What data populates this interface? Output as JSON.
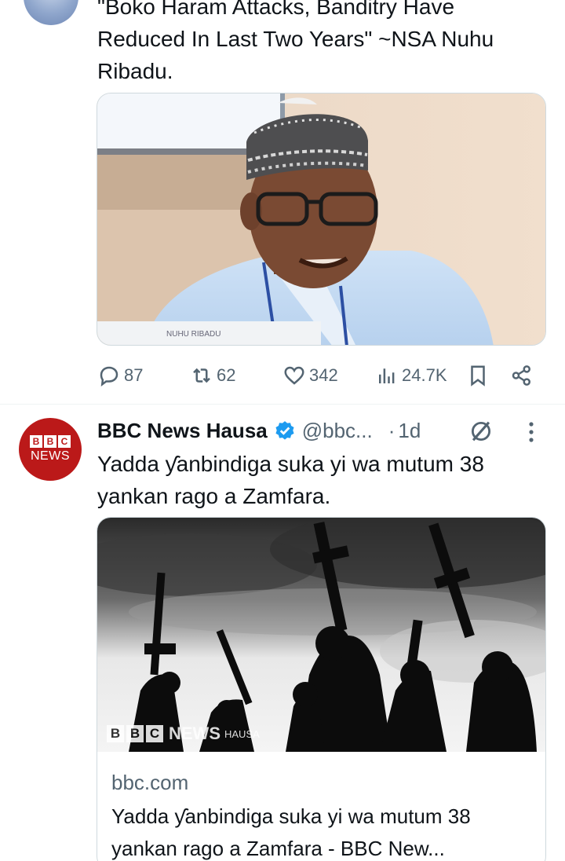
{
  "tweet1": {
    "text": "\"Boko Haram Attacks, Banditry Have\nReduced In Last Two Years\" ~NSA Nuhu\nRibadu.",
    "image_caption_plate": "NUHU RIBADU",
    "stats": {
      "replies": "87",
      "reposts": "62",
      "likes": "342",
      "views": "24.7K"
    }
  },
  "tweet2": {
    "avatar": {
      "boxes": [
        "B",
        "B",
        "C"
      ],
      "label": "NEWS",
      "color": "#bb1919"
    },
    "author_name": "BBC News Hausa",
    "handle": "@bbc...",
    "separator": "·",
    "time": "1d",
    "text": "Yadda ƴanbindiga suka yi wa mutum 38 yankan rago a Zamfara.",
    "link_card": {
      "watermark_boxes": [
        "B",
        "B",
        "C"
      ],
      "watermark_news": "NEWS",
      "watermark_hausa": "HAUSA",
      "domain": "bbc.com",
      "title": "Yadda ƴanbindiga suka yi wa mutum 38 yankan rago a Zamfara - BBC New..."
    }
  },
  "colors": {
    "text_primary": "#0f1419",
    "text_secondary": "#536471",
    "verified": "#1d9bf0",
    "border": "#cfd9de"
  },
  "icons": [
    "reply-icon",
    "repost-icon",
    "like-icon",
    "views-icon",
    "bookmark-icon",
    "share-icon",
    "verified-icon",
    "grok-icon",
    "more-icon"
  ]
}
